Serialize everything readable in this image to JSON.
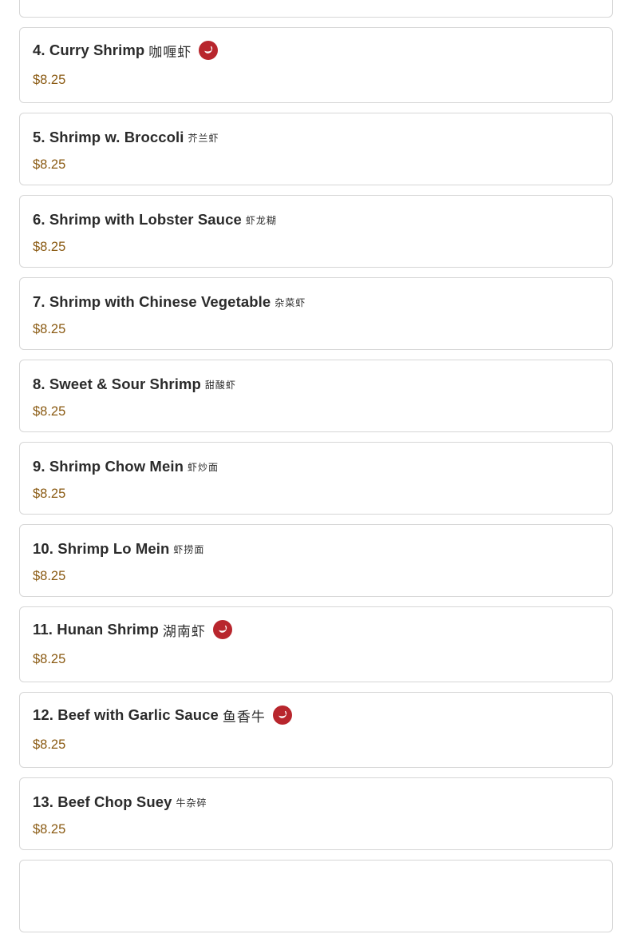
{
  "menu": {
    "items": [
      {
        "name": "",
        "cn": "",
        "price": "",
        "spicy": false
      },
      {
        "name": "4. Curry Shrimp",
        "cn": "咖喱虾",
        "price": "$8.25",
        "spicy": true
      },
      {
        "name": "5. Shrimp w. Broccoli",
        "cn": "芥兰虾",
        "price": "$8.25",
        "spicy": false
      },
      {
        "name": "6. Shrimp with Lobster Sauce",
        "cn": "虾龙糊",
        "price": "$8.25",
        "spicy": false
      },
      {
        "name": "7. Shrimp with Chinese Vegetable",
        "cn": "杂菜虾",
        "price": "$8.25",
        "spicy": false
      },
      {
        "name": "8. Sweet & Sour Shrimp",
        "cn": "甜酸虾",
        "price": "$8.25",
        "spicy": false
      },
      {
        "name": "9. Shrimp Chow Mein",
        "cn": "虾炒面",
        "price": "$8.25",
        "spicy": false
      },
      {
        "name": "10. Shrimp Lo Mein",
        "cn": "虾捞面",
        "price": "$8.25",
        "spicy": false
      },
      {
        "name": "11. Hunan Shrimp",
        "cn": "湖南虾",
        "price": "$8.25",
        "spicy": true
      },
      {
        "name": "12. Beef with Garlic Sauce",
        "cn": "鱼香牛",
        "price": "$8.25",
        "spicy": true
      },
      {
        "name": "13. Beef Chop Suey",
        "cn": "牛杂碎",
        "price": "$8.25",
        "spicy": false
      },
      {
        "name": "",
        "cn": "",
        "price": "",
        "spicy": false
      }
    ]
  },
  "icons": {
    "spicy": "chili-pepper-icon"
  },
  "colors": {
    "price": "#8a5a12",
    "spicy_badge": "#b8262d",
    "card_border": "#d6d6d6",
    "text": "#2b2b2b"
  }
}
